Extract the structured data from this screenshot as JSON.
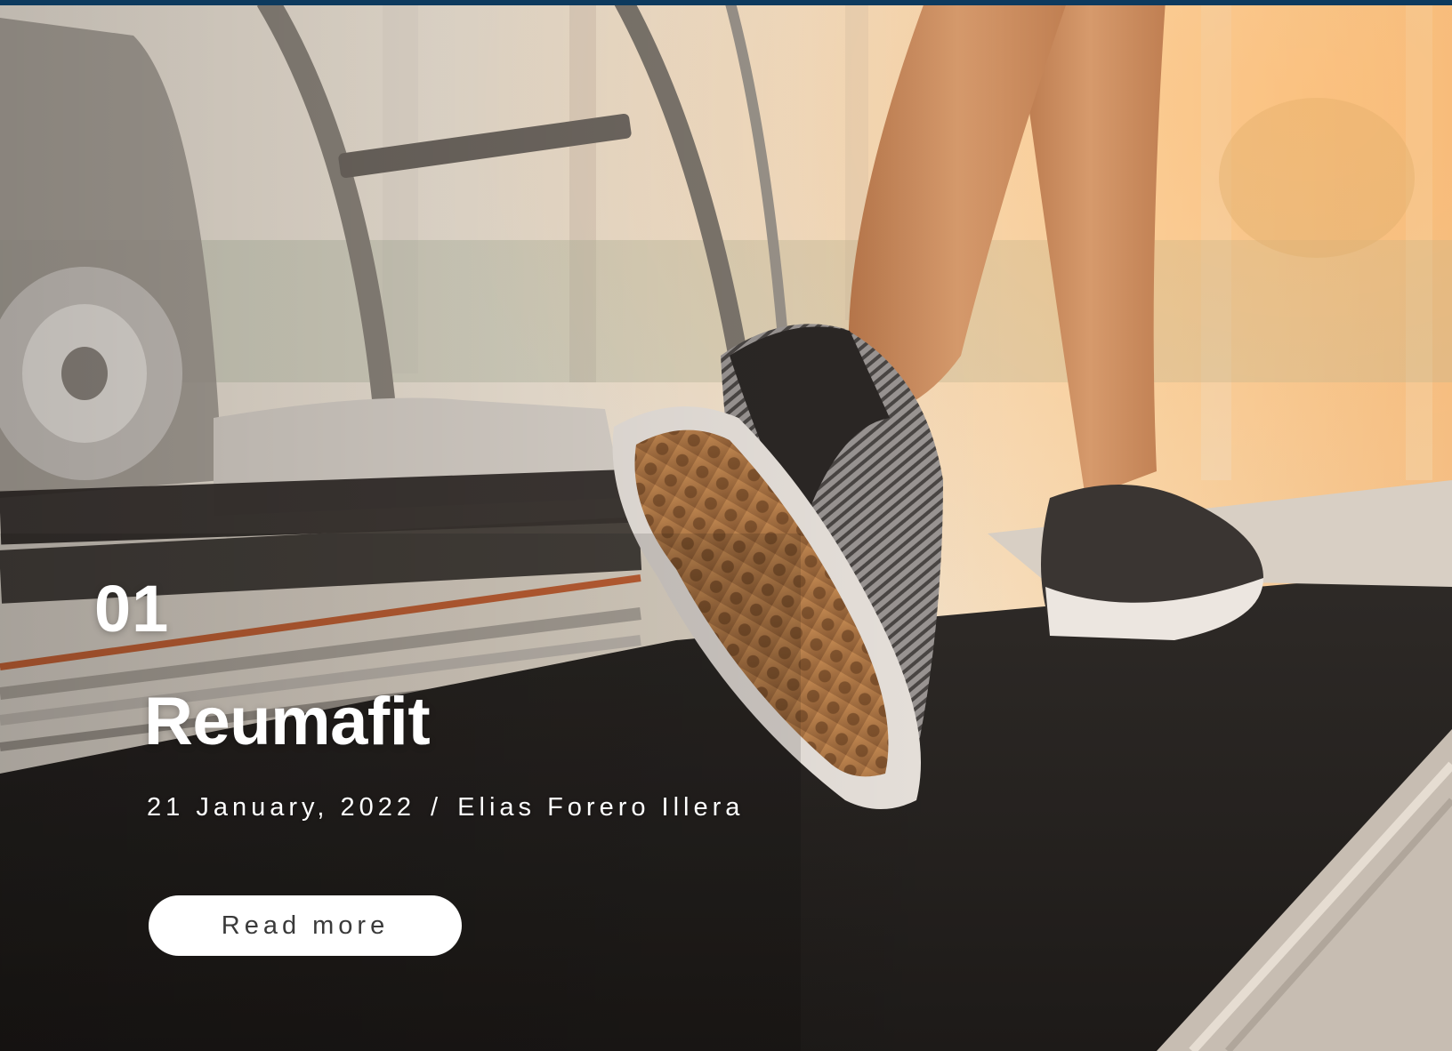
{
  "slide": {
    "number": "01",
    "title": "Reumafit",
    "date": "21 January, 2022",
    "separator": "/",
    "author": "Elias Forero Illera",
    "read_more_label": "Read more"
  },
  "colors": {
    "top_bar": "#0d3a5e",
    "text": "#ffffff",
    "button_bg": "#ffffff",
    "button_text": "#3a3a3a"
  }
}
